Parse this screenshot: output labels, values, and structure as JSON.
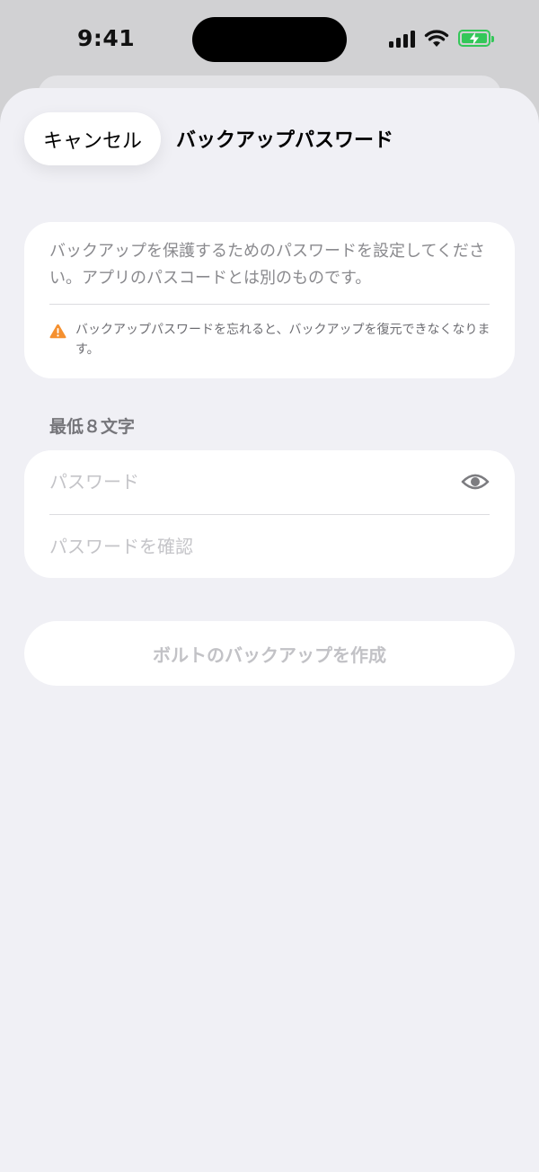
{
  "status_bar": {
    "time": "9:41",
    "battery_color": "#34c759",
    "icons": [
      "cellular-signal-icon",
      "wifi-icon",
      "battery-charging-icon"
    ]
  },
  "sheet": {
    "cancel_label": "キャンセル",
    "title": "バックアップパスワード"
  },
  "info_card": {
    "description": "バックアップを保護するためのパスワードを設定してください。アプリのパスコードとは別のものです。",
    "warning": "バックアップパスワードを忘れると、バックアップを復元できなくなります。",
    "warning_icon": "warning-triangle-icon",
    "warning_color": "#f5902f"
  },
  "form": {
    "section_label": "最低８文字",
    "password": {
      "value": "",
      "placeholder": "パスワード"
    },
    "confirm": {
      "value": "",
      "placeholder": "パスワードを確認"
    },
    "show_password_icon": "eye-icon"
  },
  "actions": {
    "create_label": "ボルトのバックアップを作成",
    "create_enabled": false
  }
}
